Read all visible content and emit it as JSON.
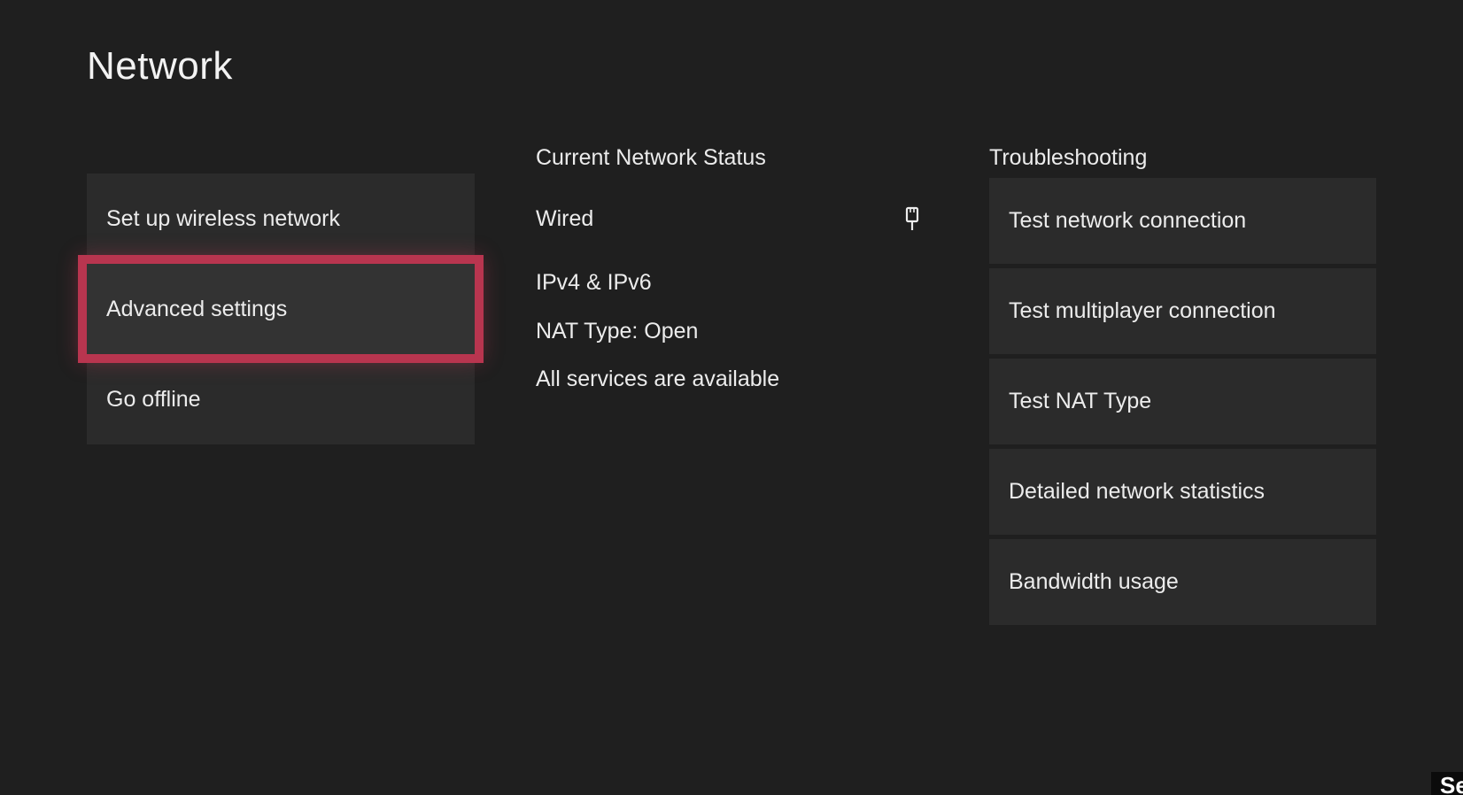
{
  "page": {
    "title": "Network"
  },
  "menu": {
    "items": [
      {
        "label": "Set up wireless network"
      },
      {
        "label": "Advanced settings",
        "focused": true
      },
      {
        "label": "Go offline"
      }
    ],
    "focus_color": "#b8354f"
  },
  "status": {
    "heading": "Current Network Status",
    "connection": "Wired",
    "connection_icon": "ethernet-plug-icon",
    "ip_version": "IPv4 & IPv6",
    "nat": "NAT Type: Open",
    "services": "All services are available"
  },
  "troubleshooting": {
    "heading": "Troubleshooting",
    "items": [
      {
        "label": "Test network connection"
      },
      {
        "label": "Test multiplayer connection"
      },
      {
        "label": "Test NAT Type"
      },
      {
        "label": "Detailed network statistics"
      },
      {
        "label": "Bandwidth usage"
      }
    ]
  },
  "corner_badge": {
    "text": "Se"
  }
}
